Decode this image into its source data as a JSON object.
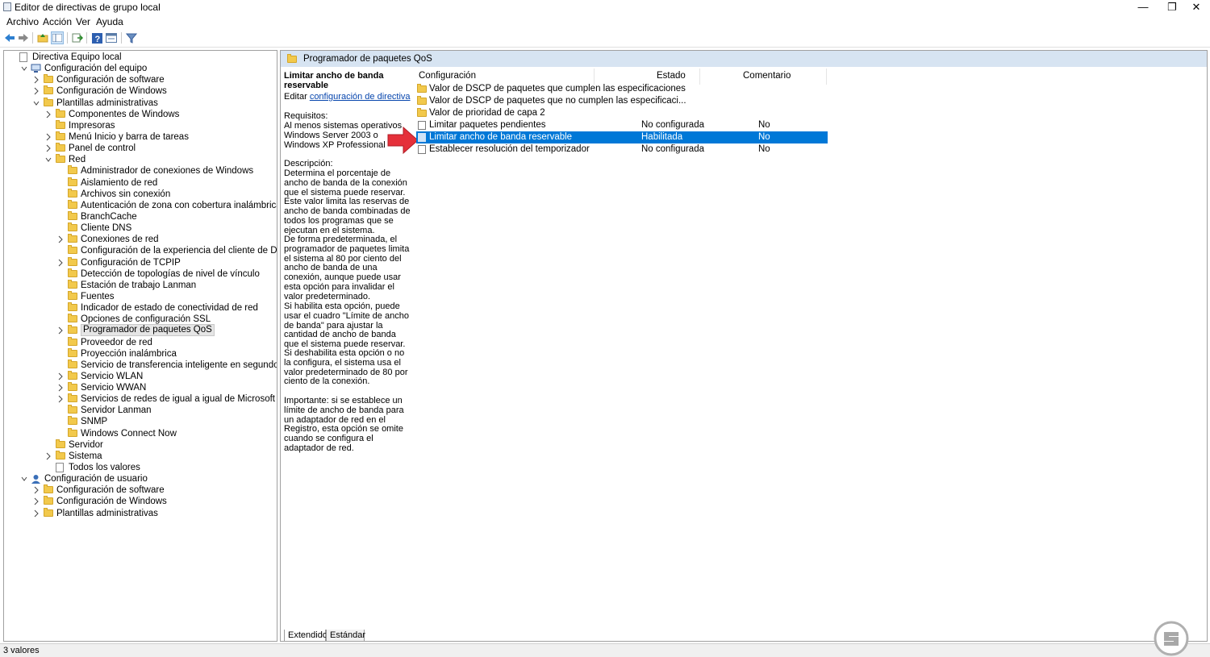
{
  "window": {
    "title": "Editor de directivas de grupo local",
    "controls": {
      "minimize": "—",
      "restore": "❐",
      "close": "✕"
    }
  },
  "menu": [
    "Archivo",
    "Acción",
    "Ver",
    "Ayuda"
  ],
  "toolbar": {
    "icons": [
      "back-arrow-icon",
      "forward-arrow-icon",
      "up-folder-icon",
      "show-hide-tree-icon",
      "export-list-icon",
      "help-icon",
      "properties-icon",
      "filter-icon"
    ]
  },
  "tree": [
    {
      "label": "Directiva Equipo local",
      "icon": "policy-doc-icon",
      "expander": ""
    },
    {
      "label": "Configuración del equipo",
      "icon": "computer-icon",
      "expander": "v"
    },
    {
      "label": "Configuración de software",
      "icon": "folder-icon",
      "expander": ">"
    },
    {
      "label": "Configuración de Windows",
      "icon": "folder-icon",
      "expander": ">"
    },
    {
      "label": "Plantillas administrativas",
      "icon": "folder-icon",
      "expander": "v"
    },
    {
      "label": "Componentes de Windows",
      "icon": "folder-icon",
      "expander": ">"
    },
    {
      "label": "Impresoras",
      "icon": "folder-icon",
      "expander": ""
    },
    {
      "label": "Menú Inicio y barra de tareas",
      "icon": "folder-icon",
      "expander": ">"
    },
    {
      "label": "Panel de control",
      "icon": "folder-icon",
      "expander": ">"
    },
    {
      "label": "Red",
      "icon": "folder-icon",
      "expander": "v"
    },
    {
      "label": "Administrador de conexiones de Windows",
      "icon": "folder-icon",
      "expander": ""
    },
    {
      "label": "Aislamiento de red",
      "icon": "folder-icon",
      "expander": ""
    },
    {
      "label": "Archivos sin conexión",
      "icon": "folder-icon",
      "expander": ""
    },
    {
      "label": "Autenticación de zona con cobertura inalámbrica",
      "icon": "folder-icon",
      "expander": ""
    },
    {
      "label": "BranchCache",
      "icon": "folder-icon",
      "expander": ""
    },
    {
      "label": "Cliente DNS",
      "icon": "folder-icon",
      "expander": ""
    },
    {
      "label": "Conexiones de red",
      "icon": "folder-icon",
      "expander": ">"
    },
    {
      "label": "Configuración de la experiencia del cliente de DirectAccess",
      "icon": "folder-icon",
      "expander": ""
    },
    {
      "label": "Configuración de TCPIP",
      "icon": "folder-icon",
      "expander": ">"
    },
    {
      "label": "Detección de topologías de nivel de vínculo",
      "icon": "folder-icon",
      "expander": ""
    },
    {
      "label": "Estación de trabajo Lanman",
      "icon": "folder-icon",
      "expander": ""
    },
    {
      "label": "Fuentes",
      "icon": "folder-icon",
      "expander": ""
    },
    {
      "label": "Indicador de estado de conectividad de red",
      "icon": "folder-icon",
      "expander": ""
    },
    {
      "label": "Opciones de configuración SSL",
      "icon": "folder-icon",
      "expander": ""
    },
    {
      "label": "Programador de paquetes QoS",
      "icon": "folder-icon",
      "expander": ">",
      "selected": true
    },
    {
      "label": "Proveedor de red",
      "icon": "folder-icon",
      "expander": ""
    },
    {
      "label": "Proyección inalámbrica",
      "icon": "folder-icon",
      "expander": ""
    },
    {
      "label": "Servicio de transferencia inteligente en segundo plano (BITS)",
      "icon": "folder-icon",
      "expander": ""
    },
    {
      "label": "Servicio WLAN",
      "icon": "folder-icon",
      "expander": ">"
    },
    {
      "label": "Servicio WWAN",
      "icon": "folder-icon",
      "expander": ">"
    },
    {
      "label": "Servicios de redes de igual a igual de Microsoft",
      "icon": "folder-icon",
      "expander": ">"
    },
    {
      "label": "Servidor Lanman",
      "icon": "folder-icon",
      "expander": ""
    },
    {
      "label": "SNMP",
      "icon": "folder-icon",
      "expander": ""
    },
    {
      "label": "Windows Connect Now",
      "icon": "folder-icon",
      "expander": ""
    },
    {
      "label": "Servidor",
      "icon": "folder-icon",
      "expander": ""
    },
    {
      "label": "Sistema",
      "icon": "folder-icon",
      "expander": ">"
    },
    {
      "label": "Todos los valores",
      "icon": "policy-doc-icon",
      "expander": ""
    },
    {
      "label": "Configuración de usuario",
      "icon": "user-icon",
      "expander": "v"
    },
    {
      "label": "Configuración de software",
      "icon": "folder-icon",
      "expander": ">"
    },
    {
      "label": "Configuración de Windows",
      "icon": "folder-icon",
      "expander": ">"
    },
    {
      "label": "Plantillas administrativas",
      "icon": "folder-icon",
      "expander": ">"
    }
  ],
  "pane_header": "Programador de paquetes QoS",
  "description": {
    "title": "Limitar ancho de banda reservable",
    "edit_prefix": "Editar",
    "edit_link": "configuración de directiva",
    "requirements_label": "Requisitos:",
    "requirements_text": "Al menos sistemas operativos Windows Server 2003 o Windows XP Professional",
    "description_label": "Descripción:",
    "paragraphs": [
      "Determina el porcentaje de ancho de banda de la conexión que el sistema puede reservar. Este valor limita las reservas de ancho de banda combinadas de todos los programas que se ejecutan en el sistema.",
      "De forma predeterminada, el programador de paquetes limita el sistema al 80 por ciento del ancho de banda de una conexión, aunque puede usar esta opción para invalidar el valor predeterminado.",
      "Si habilita esta opción, puede usar el cuadro \"Límite de ancho de banda\" para ajustar la cantidad de ancho de banda que el sistema puede reservar.",
      "Si deshabilita esta opción o no la configura, el sistema usa el valor predeterminado de 80 por ciento de la conexión.",
      "Importante: si se establece un límite de ancho de banda para un adaptador de red en el Registro, esta opción se omite cuando se configura el adaptador de red."
    ]
  },
  "list": {
    "columns": [
      "Configuración",
      "Estado",
      "Comentario"
    ],
    "rows": [
      {
        "name": "Valor de DSCP de paquetes que cumplen las especificaciones",
        "state": "",
        "comment": "",
        "icon": "folder-icon"
      },
      {
        "name": "Valor de DSCP de paquetes que no cumplen las especificaci...",
        "state": "",
        "comment": "",
        "icon": "folder-icon"
      },
      {
        "name": "Valor de prioridad de capa 2",
        "state": "",
        "comment": "",
        "icon": "folder-icon"
      },
      {
        "name": "Limitar paquetes pendientes",
        "state": "No configurada",
        "comment": "No",
        "icon": "policy-setting-icon"
      },
      {
        "name": "Limitar ancho de banda reservable",
        "state": "Habilitada",
        "comment": "No",
        "icon": "policy-setting-icon",
        "selected": true
      },
      {
        "name": "Establecer resolución del temporizador",
        "state": "No configurada",
        "comment": "No",
        "icon": "policy-setting-icon"
      }
    ]
  },
  "tabs": [
    "Extendido",
    "Estándar"
  ],
  "status": "3 valores",
  "colors": {
    "selection": "#0078d7",
    "header": "#d7e4f2",
    "arrow": "#e5303a",
    "folder": "#f2c94c"
  }
}
